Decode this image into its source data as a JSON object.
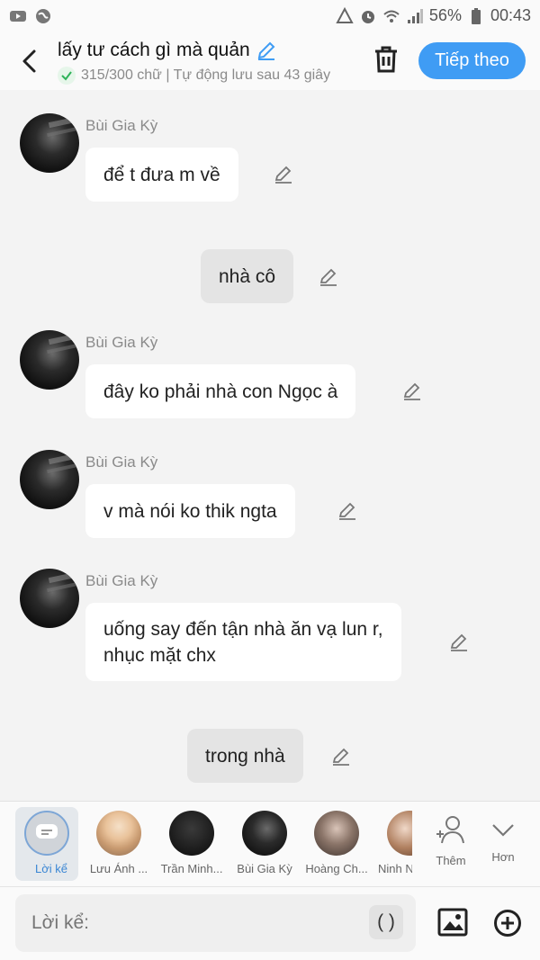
{
  "status": {
    "battery": "56%",
    "time": "00:43"
  },
  "header": {
    "title": "lấy tư cách gì mà quản",
    "subtitle": "315/300 chữ | Tự động lưu sau 43 giây",
    "next_label": "Tiếp theo"
  },
  "messages": [
    {
      "sender": "Bùi Gia Kỳ",
      "text": "để t đưa m về"
    },
    {
      "text": "nhà cô"
    },
    {
      "sender": "Bùi Gia Kỳ",
      "text": "đây ko phải nhà con Ngọc à"
    },
    {
      "sender": "Bùi Gia Kỳ",
      "text": "v mà nói ko thik ngta"
    },
    {
      "sender": "Bùi Gia Kỳ",
      "text": "uống say đến tận nhà ăn vạ lun r,\nnhục mặt chx"
    },
    {
      "text": "trong nhà"
    }
  ],
  "strip": {
    "narrator": "Lời kể",
    "characters": [
      "Lưu Ánh ...",
      "Trần Minh...",
      "Bùi Gia Kỳ",
      "Hoàng Ch...",
      "Ninh N"
    ],
    "add_label": "Thêm",
    "more_label": "Hơn"
  },
  "input": {
    "placeholder": "Lời kể:",
    "paren": "( )"
  }
}
